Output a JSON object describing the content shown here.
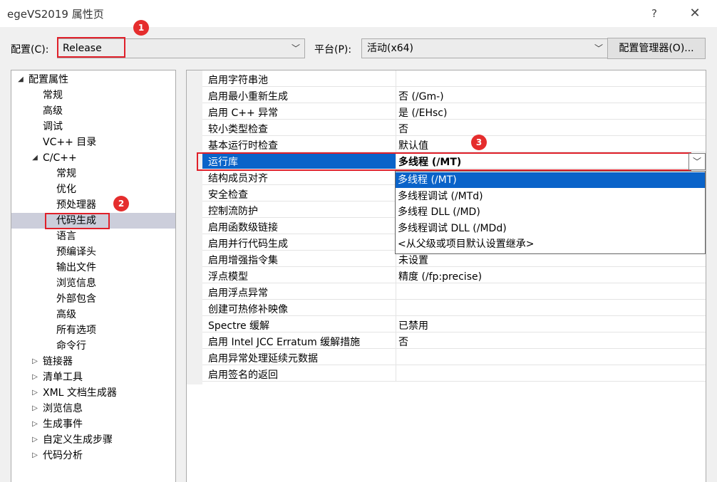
{
  "window": {
    "title": "egeVS2019 属性页",
    "help": "?",
    "close": "✕"
  },
  "toolbar": {
    "config_label": "配置(C):",
    "config_value": "Release",
    "platform_label": "平台(P):",
    "platform_value": "活动(x64)",
    "manager_button": "配置管理器(O)..."
  },
  "badges": [
    "1",
    "2",
    "3"
  ],
  "tree": [
    {
      "label": "配置属性",
      "arrow": "◢",
      "level": 0
    },
    {
      "label": "常规",
      "level": 1
    },
    {
      "label": "高级",
      "level": 1
    },
    {
      "label": "调试",
      "level": 1
    },
    {
      "label": "VC++ 目录",
      "level": 1
    },
    {
      "label": "C/C++",
      "arrow": "◢",
      "level": 1
    },
    {
      "label": "常规",
      "level": 2
    },
    {
      "label": "优化",
      "level": 2
    },
    {
      "label": "预处理器",
      "level": 2
    },
    {
      "label": "代码生成",
      "level": 2,
      "selected": true
    },
    {
      "label": "语言",
      "level": 2
    },
    {
      "label": "预编译头",
      "level": 2
    },
    {
      "label": "输出文件",
      "level": 2
    },
    {
      "label": "浏览信息",
      "level": 2
    },
    {
      "label": "外部包含",
      "level": 2
    },
    {
      "label": "高级",
      "level": 2
    },
    {
      "label": "所有选项",
      "level": 2
    },
    {
      "label": "命令行",
      "level": 2
    },
    {
      "label": "链接器",
      "arrow": "▷",
      "level": 1
    },
    {
      "label": "清单工具",
      "arrow": "▷",
      "level": 1
    },
    {
      "label": "XML 文档生成器",
      "arrow": "▷",
      "level": 1
    },
    {
      "label": "浏览信息",
      "arrow": "▷",
      "level": 1
    },
    {
      "label": "生成事件",
      "arrow": "▷",
      "level": 1
    },
    {
      "label": "自定义生成步骤",
      "arrow": "▷",
      "level": 1
    },
    {
      "label": "代码分析",
      "arrow": "▷",
      "level": 1
    }
  ],
  "properties": [
    {
      "name": "启用字符串池",
      "value": ""
    },
    {
      "name": "启用最小重新生成",
      "value": "否 (/Gm-)"
    },
    {
      "name": "启用 C++ 异常",
      "value": "是 (/EHsc)"
    },
    {
      "name": "较小类型检查",
      "value": "否"
    },
    {
      "name": "基本运行时检查",
      "value": "默认值"
    },
    {
      "name": "运行库",
      "value": "多线程 (/MT)",
      "selected": true
    },
    {
      "name": "结构成员对齐",
      "value": ""
    },
    {
      "name": "安全检查",
      "value": ""
    },
    {
      "name": "控制流防护",
      "value": ""
    },
    {
      "name": "启用函数级链接",
      "value": ""
    },
    {
      "name": "启用并行代码生成",
      "value": ""
    },
    {
      "name": "启用增强指令集",
      "value": "未设置"
    },
    {
      "name": "浮点模型",
      "value": "精度 (/fp:precise)"
    },
    {
      "name": "启用浮点异常",
      "value": ""
    },
    {
      "name": "创建可热修补映像",
      "value": ""
    },
    {
      "name": "Spectre 缓解",
      "value": "已禁用"
    },
    {
      "name": "启用 Intel JCC Erratum 缓解措施",
      "value": "否"
    },
    {
      "name": "启用异常处理延续元数据",
      "value": ""
    },
    {
      "name": "启用签名的返回",
      "value": ""
    }
  ],
  "dropdown_options": [
    {
      "label": "多线程 (/MT)",
      "highlighted": true
    },
    {
      "label": "多线程调试 (/MTd)"
    },
    {
      "label": "多线程 DLL (/MD)"
    },
    {
      "label": "多线程调试 DLL (/MDd)"
    },
    {
      "label": "<从父级或项目默认设置继承>"
    }
  ]
}
